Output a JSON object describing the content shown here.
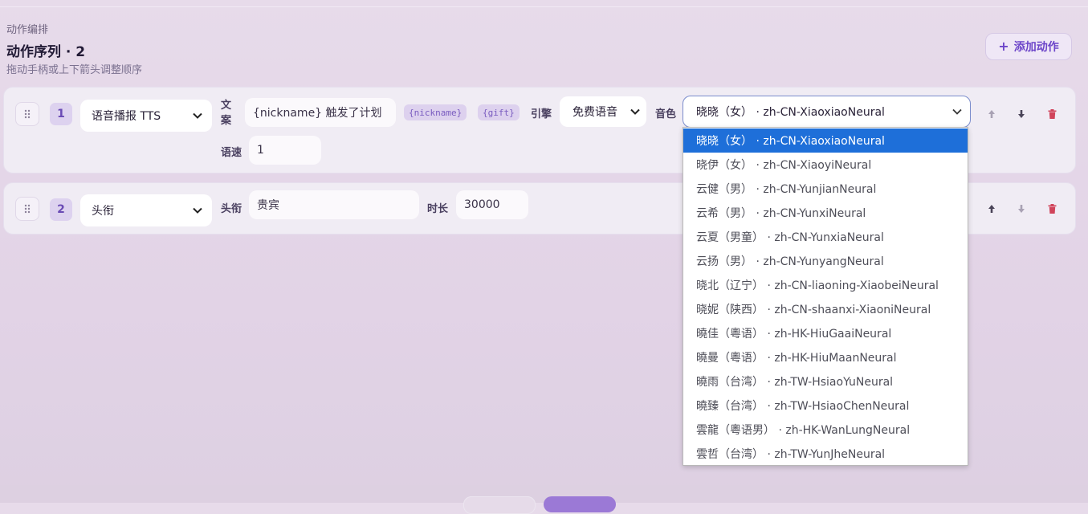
{
  "header": {
    "eyebrow": "动作编排",
    "title": "动作序列 · 2",
    "subtitle": "拖动手柄或上下箭头调整顺序",
    "add_button": "添加动作",
    "add_icon": "plus-icon"
  },
  "actions": [
    {
      "index": "1",
      "type": "语音播报 TTS",
      "text_label": "文案",
      "text_value": "{nickname} 触发了计划",
      "chips": [
        "{nickname}",
        "{gift}"
      ],
      "engine_label": "引擎",
      "engine_value": "免费语音",
      "voice_label": "音色",
      "voice_value": "晓晓（女） · zh-CN-XiaoxiaoNeural",
      "speed_label": "语速",
      "speed_value": "1"
    },
    {
      "index": "2",
      "type": "头衔",
      "title_label": "头衔",
      "title_value": "贵宾",
      "duration_label": "时长",
      "duration_value": "30000"
    }
  ],
  "voice_options": [
    "晓晓（女） · zh-CN-XiaoxiaoNeural",
    "晓伊（女） · zh-CN-XiaoyiNeural",
    "云健（男） · zh-CN-YunjianNeural",
    "云希（男） · zh-CN-YunxiNeural",
    "云夏（男童） · zh-CN-YunxiaNeural",
    "云扬（男） · zh-CN-YunyangNeural",
    "晓北（辽宁） · zh-CN-liaoning-XiaobeiNeural",
    "晓妮（陕西） · zh-CN-shaanxi-XiaoniNeural",
    "曉佳（粵语） · zh-HK-HiuGaaiNeural",
    "曉曼（粵语） · zh-HK-HiuMaanNeural",
    "曉雨（台湾） · zh-TW-HsiaoYuNeural",
    "曉臻（台湾） · zh-TW-HsiaoChenNeural",
    "雲龍（粵语男） · zh-HK-WanLungNeural",
    "雲哲（台湾） · zh-TW-YunJheNeural"
  ],
  "selected_voice_index": 0,
  "colors": {
    "accent": "#6c45c9",
    "selected_option": "#1e6fd9",
    "delete": "#d0435a"
  }
}
